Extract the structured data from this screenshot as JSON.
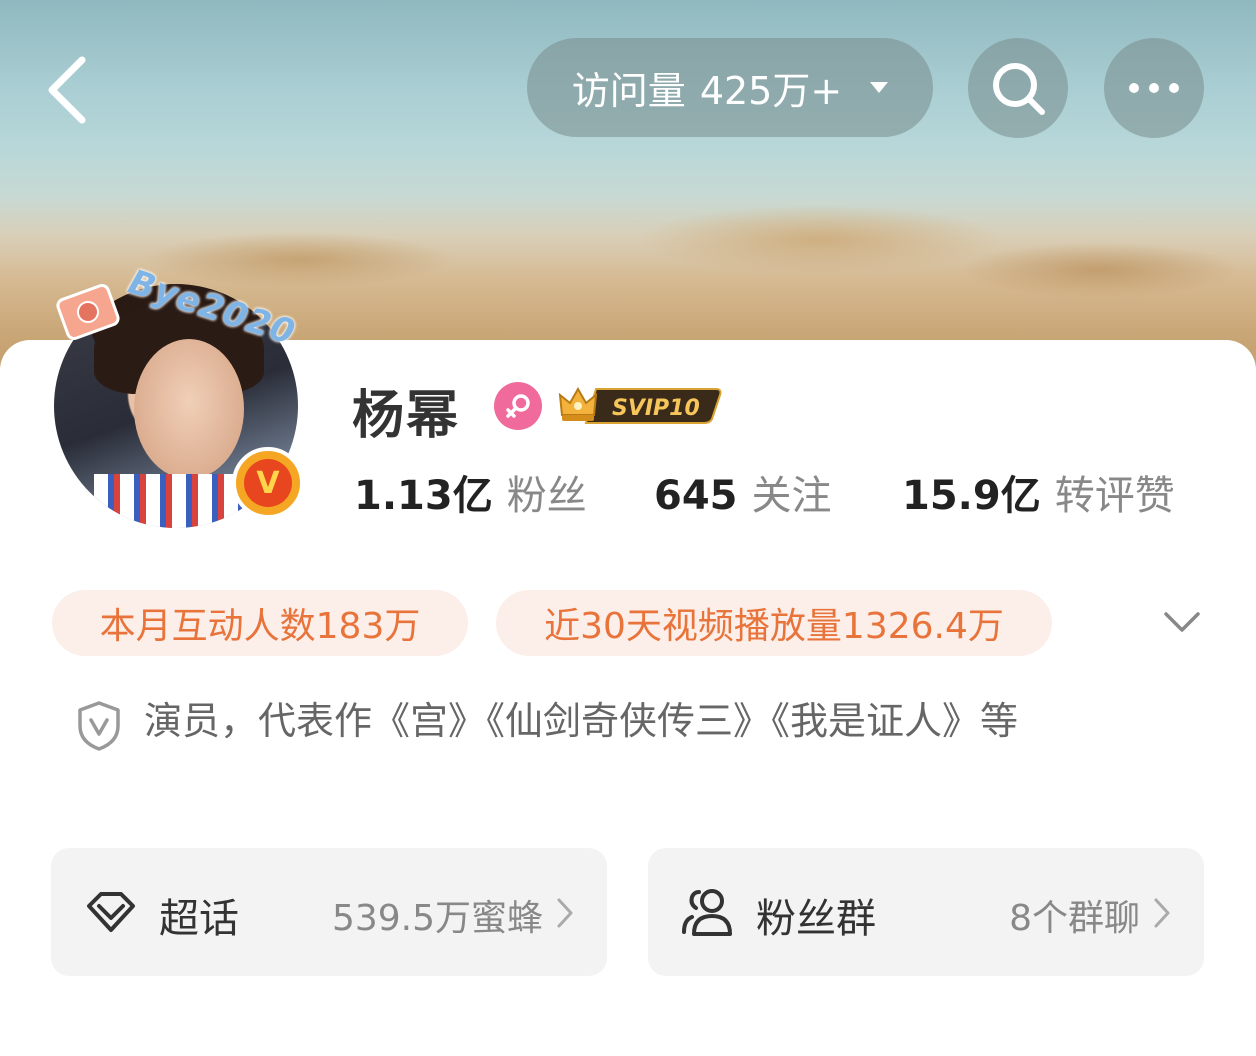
{
  "header": {
    "visits_label": "访问量",
    "visits_value": "425万+"
  },
  "profile": {
    "name": "杨幂",
    "avatar_decoration_text": "Bye2020",
    "svip_badge": "SVIP10",
    "verified_badge": "V"
  },
  "stats": [
    {
      "value": "1.13亿",
      "label": "粉丝"
    },
    {
      "value": "645",
      "label": "关注"
    },
    {
      "value": "15.9亿",
      "label": "转评赞"
    }
  ],
  "chips": [
    "本月互动人数183万",
    "近30天视频播放量1326.4万"
  ],
  "description": "演员，代表作《宫》《仙剑奇侠传三》《我是证人》等",
  "entries": [
    {
      "label": "超话",
      "value": "539.5万蜜蜂"
    },
    {
      "label": "粉丝群",
      "value": "8个群聊"
    }
  ],
  "colors": {
    "accent_orange": "#e8743b",
    "chip_bg": "#fcefe9",
    "gender_pink": "#f06a9b",
    "verified_orange": "#f5a623"
  },
  "icons": {
    "back": "chevron-left-icon",
    "visits_dropdown": "caret-down-icon",
    "search": "search-icon",
    "more": "more-icon",
    "gender": "female-icon",
    "expand": "chevron-down-icon",
    "verification": "shield-v-icon",
    "super_topic": "diamond-icon",
    "fan_group": "users-icon",
    "entry_arrow": "chevron-right-icon"
  }
}
